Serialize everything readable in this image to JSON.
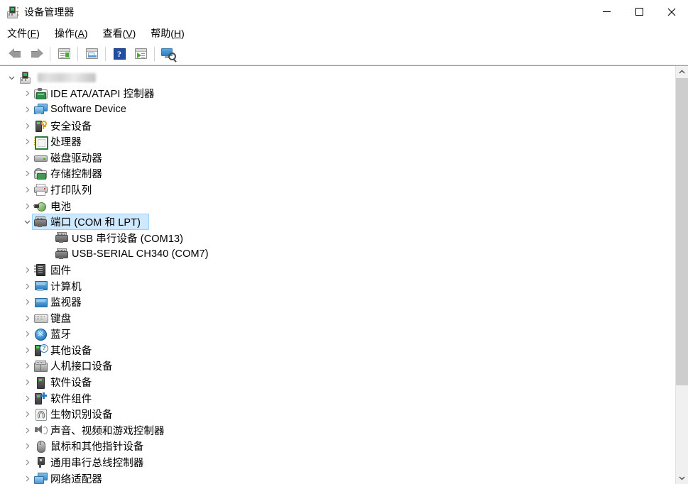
{
  "window": {
    "title": "设备管理器",
    "icon": "device-manager-icon",
    "caption": {
      "minimize": "最小化",
      "maximize": "最大化",
      "close": "关闭"
    }
  },
  "menubar": {
    "items": [
      {
        "label": "文件(F)",
        "text": "文件",
        "accel": "F"
      },
      {
        "label": "操作(A)",
        "text": "操作",
        "accel": "A"
      },
      {
        "label": "查看(V)",
        "text": "查看",
        "accel": "V"
      },
      {
        "label": "帮助(H)",
        "text": "帮助",
        "accel": "H"
      }
    ]
  },
  "toolbar": {
    "buttons": [
      {
        "name": "back-button",
        "icon": "arrow-left-icon"
      },
      {
        "name": "forward-button",
        "icon": "arrow-right-icon"
      },
      {
        "name": "show-hide-console-tree-button",
        "icon": "console-tree-icon"
      },
      {
        "name": "properties-button",
        "icon": "properties-icon"
      },
      {
        "name": "help-button",
        "icon": "help-icon",
        "glyph": "?"
      },
      {
        "name": "update-driver-button",
        "icon": "update-driver-icon"
      },
      {
        "name": "scan-hardware-changes-button",
        "icon": "scan-hardware-icon"
      }
    ]
  },
  "tree": {
    "root": {
      "label": "",
      "redacted": true,
      "icon": "computer-icon",
      "expanded": true
    },
    "items": [
      {
        "label": "IDE ATA/ATAPI 控制器",
        "icon": "ide-controller-icon",
        "expanded": false,
        "indent": 1,
        "selected": false
      },
      {
        "label": "Software Device",
        "icon": "software-device-icon",
        "expanded": false,
        "indent": 1,
        "selected": false
      },
      {
        "label": "安全设备",
        "icon": "security-device-icon",
        "expanded": false,
        "indent": 1,
        "selected": false
      },
      {
        "label": "处理器",
        "icon": "processor-icon",
        "expanded": false,
        "indent": 1,
        "selected": false
      },
      {
        "label": "磁盘驱动器",
        "icon": "disk-drive-icon",
        "expanded": false,
        "indent": 1,
        "selected": false
      },
      {
        "label": "存储控制器",
        "icon": "storage-controller-icon",
        "expanded": false,
        "indent": 1,
        "selected": false
      },
      {
        "label": "打印队列",
        "icon": "print-queue-icon",
        "expanded": false,
        "indent": 1,
        "selected": false
      },
      {
        "label": "电池",
        "icon": "battery-icon",
        "expanded": false,
        "indent": 1,
        "selected": false
      },
      {
        "label": "端口 (COM 和 LPT)",
        "icon": "port-icon",
        "expanded": true,
        "indent": 1,
        "selected": true
      },
      {
        "label": "USB 串行设备 (COM13)",
        "icon": "port-icon",
        "expanded": null,
        "indent": 2,
        "selected": false
      },
      {
        "label": "USB-SERIAL CH340 (COM7)",
        "icon": "port-icon",
        "expanded": null,
        "indent": 2,
        "selected": false
      },
      {
        "label": "固件",
        "icon": "firmware-icon",
        "expanded": false,
        "indent": 1,
        "selected": false
      },
      {
        "label": "计算机",
        "icon": "computer-monitor-icon",
        "expanded": false,
        "indent": 1,
        "selected": false
      },
      {
        "label": "监视器",
        "icon": "monitor-icon",
        "expanded": false,
        "indent": 1,
        "selected": false
      },
      {
        "label": "键盘",
        "icon": "keyboard-icon",
        "expanded": false,
        "indent": 1,
        "selected": false
      },
      {
        "label": "蓝牙",
        "icon": "bluetooth-icon",
        "expanded": false,
        "indent": 1,
        "selected": false
      },
      {
        "label": "其他设备",
        "icon": "other-devices-icon",
        "expanded": false,
        "indent": 1,
        "selected": false
      },
      {
        "label": "人机接口设备",
        "icon": "hid-icon",
        "expanded": false,
        "indent": 1,
        "selected": false
      },
      {
        "label": "软件设备",
        "icon": "software-tower-icon",
        "expanded": false,
        "indent": 1,
        "selected": false
      },
      {
        "label": "软件组件",
        "icon": "software-component-icon",
        "expanded": false,
        "indent": 1,
        "selected": false
      },
      {
        "label": "生物识别设备",
        "icon": "biometric-icon",
        "expanded": false,
        "indent": 1,
        "selected": false
      },
      {
        "label": "声音、视频和游戏控制器",
        "icon": "sound-icon",
        "expanded": false,
        "indent": 1,
        "selected": false
      },
      {
        "label": "鼠标和其他指针设备",
        "icon": "mouse-icon",
        "expanded": false,
        "indent": 1,
        "selected": false
      },
      {
        "label": "通用串行总线控制器",
        "icon": "usb-icon",
        "expanded": false,
        "indent": 1,
        "selected": false
      },
      {
        "label": "网络适配器",
        "icon": "network-adapter-icon",
        "expanded": false,
        "indent": 1,
        "selected": false
      }
    ]
  },
  "scrollbar": {
    "up_arrow": "scroll-up-icon",
    "down_arrow": "scroll-down-icon",
    "thumb_percent": 78
  },
  "colors": {
    "selection_fill": "#cde8ff",
    "selection_border": "#99d1ff",
    "window_bg": "#ffffff",
    "scrollbar_thumb": "#cdcdcd",
    "scrollbar_track": "#f0f0f0"
  }
}
